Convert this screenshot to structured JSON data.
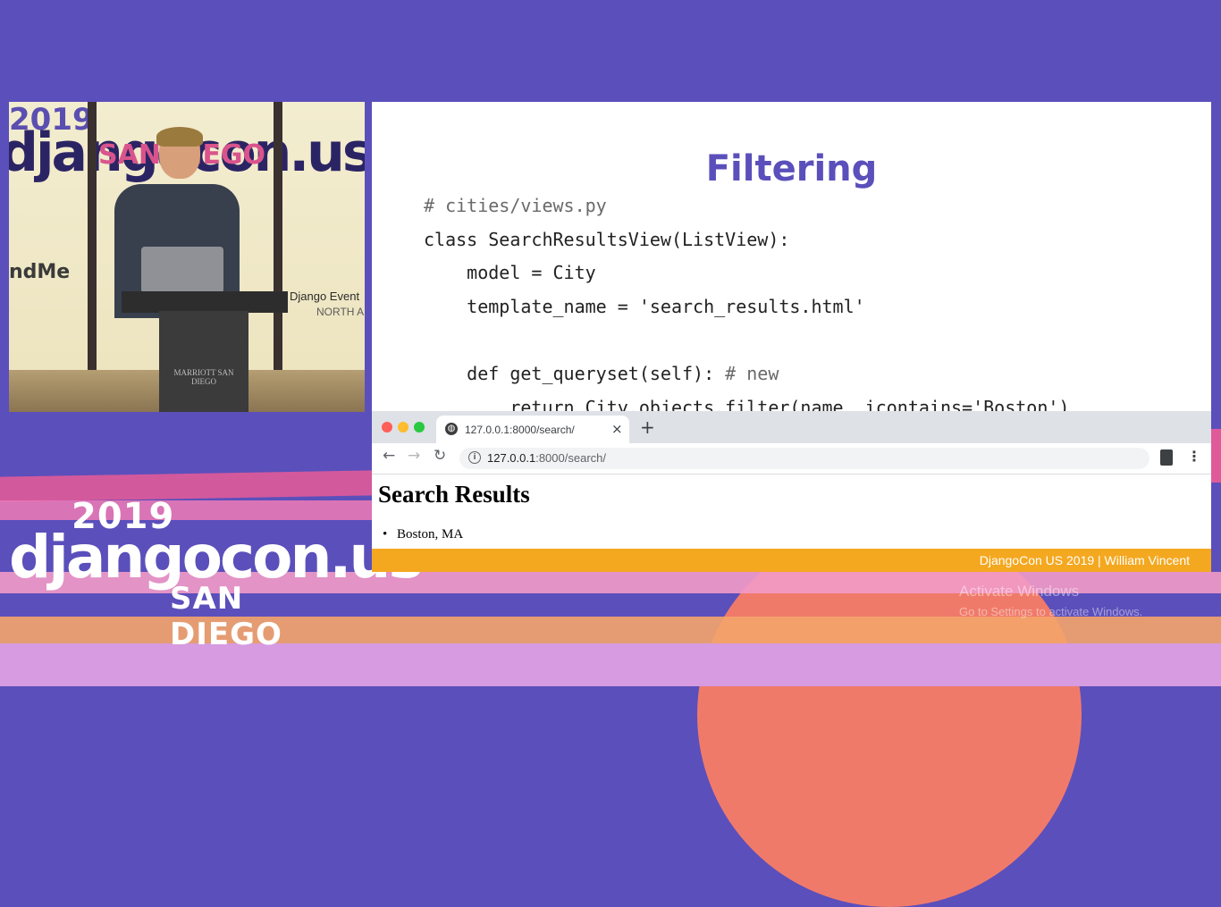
{
  "background": {
    "logo": {
      "year": "2019",
      "word": "djangocon.us",
      "city": "SAN DIEGO"
    },
    "watermark": {
      "title": "Activate Windows",
      "subtitle": "Go to Settings to activate Windows."
    }
  },
  "video": {
    "banner_year": "2019",
    "banner_word": "djangocon.us",
    "banner_city": "SAN DIEGO",
    "banner_sponsor": "ndMe",
    "banner_events": "Django Event",
    "banner_events_sub": "NORTH A",
    "podium_text": "MARRIOTT SAN DIEGO"
  },
  "slide": {
    "title": "Filtering",
    "code": {
      "comment": "# cities/views.py",
      "line1": "class SearchResultsView(ListView):",
      "line2": "    model = City",
      "line3": "    template_name = 'search_results.html'",
      "line4": "",
      "line5_code": "    def get_queryset(self): ",
      "line5_comment": "# new",
      "line6": "        return City.objects.filter(name__icontains='Boston')"
    },
    "browser": {
      "tab_title": "127.0.0.1:8000/search/",
      "url_host": "127.0.0.1",
      "url_rest": ":8000/search/",
      "page_heading": "Search Results",
      "results": [
        "Boston, MA"
      ]
    },
    "footer": "DjangoCon US 2019 | William Vincent"
  },
  "colors": {
    "accent": "#5b4fbb",
    "footer": "#f4a820"
  }
}
